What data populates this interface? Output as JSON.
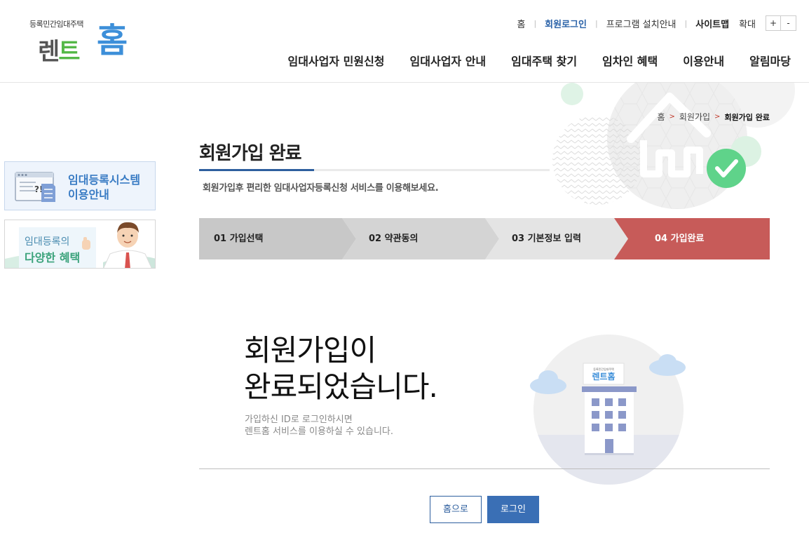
{
  "logo": {
    "tagline": "등록민간임대주택",
    "name_part1": "렌",
    "name_part2": "트",
    "name_big": "홈"
  },
  "util_links": {
    "home": "홈",
    "member_login": "회원로그인",
    "program_install": "프로그램 설치안내",
    "sitemap": "사이트맵",
    "zoom_label": "확대",
    "zoom_in": "+",
    "zoom_out": "-"
  },
  "gnb": [
    "임대사업자 민원신청",
    "임대사업자 안내",
    "임대주택 찾기",
    "임차인 혜택",
    "이용안내",
    "알림마당"
  ],
  "breadcrumb": {
    "home": "홈",
    "level1": "회원가입",
    "current": "회원가입 완료"
  },
  "side_banners": {
    "banner1_line1": "임대등록시스템",
    "banner1_line2": "이용안내",
    "banner2_line1": "임대등록의",
    "banner2_line2": "다양한 혜택"
  },
  "page": {
    "title": "회원가입 완료",
    "description": "회원가입후 편리한 임대사업자등록신청 서비스를 이용해보세요."
  },
  "steps": [
    {
      "label": "01 가입선택",
      "state": "done"
    },
    {
      "label": "02 약관동의",
      "state": "done"
    },
    {
      "label": "03 기본정보 입력",
      "state": "done"
    },
    {
      "label": "04 가입완료",
      "state": "current"
    }
  ],
  "complete": {
    "headline_line1": "회원가입이",
    "headline_line2": "완료되었습니다.",
    "sub_line1": "가입하신 ID로 로그인하시면",
    "sub_line2": "렌트홈 서비스를 이용하실 수 있습니다.",
    "building_sign_small": "등록민간임대주택",
    "building_sign_main": "렌트홈"
  },
  "buttons": {
    "home": "홈으로",
    "login": "로그인"
  },
  "colors": {
    "brand_blue": "#2e5f9e",
    "logo_blue": "#3d8fd9",
    "logo_green": "#55b848",
    "step_current": "#c75b59",
    "check_green": "#5fd38a"
  },
  "icons": {
    "house_check": "house-check-icon",
    "document_search": "document-search-icon"
  }
}
